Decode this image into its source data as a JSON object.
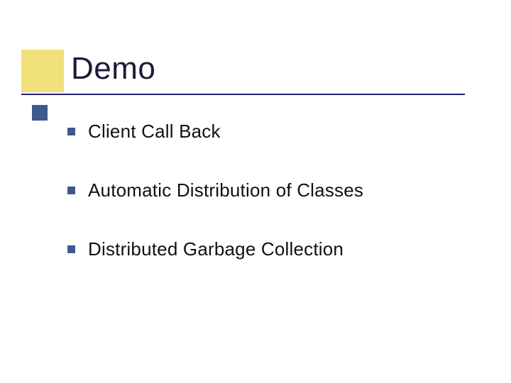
{
  "title": "Demo",
  "bullets": [
    {
      "text": "Client Call Back"
    },
    {
      "text": "Automatic Distribution of Classes"
    },
    {
      "text": "Distributed Garbage Collection"
    }
  ]
}
